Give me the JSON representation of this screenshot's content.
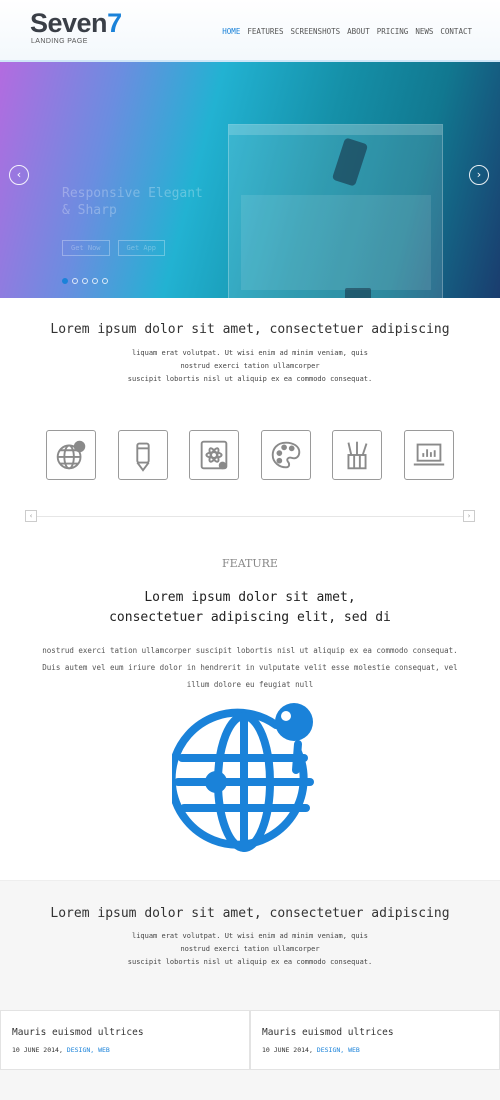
{
  "header": {
    "logo_text": "Seven",
    "logo_num": "7",
    "logo_sub": "LANDING PAGE",
    "nav": [
      "HOME",
      "FEATURES",
      "SCREENSHOTS",
      "ABOUT",
      "PRICING",
      "NEWS",
      "CONTACT"
    ],
    "active_nav": "HOME"
  },
  "hero": {
    "faded_text": [
      "Responsive Elegant",
      "& Sharp"
    ],
    "faded_buttons": [
      "Get Now",
      "Get App"
    ],
    "prev_icon": "chevron-left-icon",
    "next_icon": "chevron-right-icon",
    "slide_count": 5,
    "active_slide": 1
  },
  "intro": {
    "title": "Lorem ipsum dolor sit amet, consectetuer adipiscing",
    "lines": [
      "liquam erat volutpat. Ut wisi enim ad minim veniam, quis",
      "nostrud exerci tation ullamcorper",
      "suscipit lobortis nisl ut aliquip ex ea commodo consequat."
    ]
  },
  "icons": [
    "globe-pin-icon",
    "pencil-icon",
    "tablet-atom-icon",
    "palette-icon",
    "pencil-cup-icon",
    "laptop-chart-icon"
  ],
  "feature": {
    "label": "FEATURE",
    "heading": [
      "Lorem ipsum dolor sit amet,",
      "consectetuer adipiscing elit, sed di"
    ],
    "body": "nostrud exerci tation ullamcorper suscipit lobortis nisl ut aliquip ex ea commodo consequat. Duis autem vel eum iriure dolor in hendrerit in vulputate velit esse molestie consequat, vel illum dolore eu feugiat null",
    "accent": "#1a82d9"
  },
  "news_intro": {
    "title": "Lorem ipsum dolor sit amet, consectetuer adipiscing",
    "lines": [
      "liquam erat volutpat. Ut wisi enim ad minim veniam, quis",
      "nostrud exerci tation ullamcorper",
      "suscipit lobortis nisl ut aliquip ex ea commodo consequat."
    ]
  },
  "posts": [
    {
      "title": "Mauris euismod ultrices",
      "date": "10 JUNE 2014,",
      "tags": "DESIGN, WEB"
    },
    {
      "title": "Mauris euismod ultrices",
      "date": "10 JUNE 2014,",
      "tags": "DESIGN, WEB"
    }
  ]
}
